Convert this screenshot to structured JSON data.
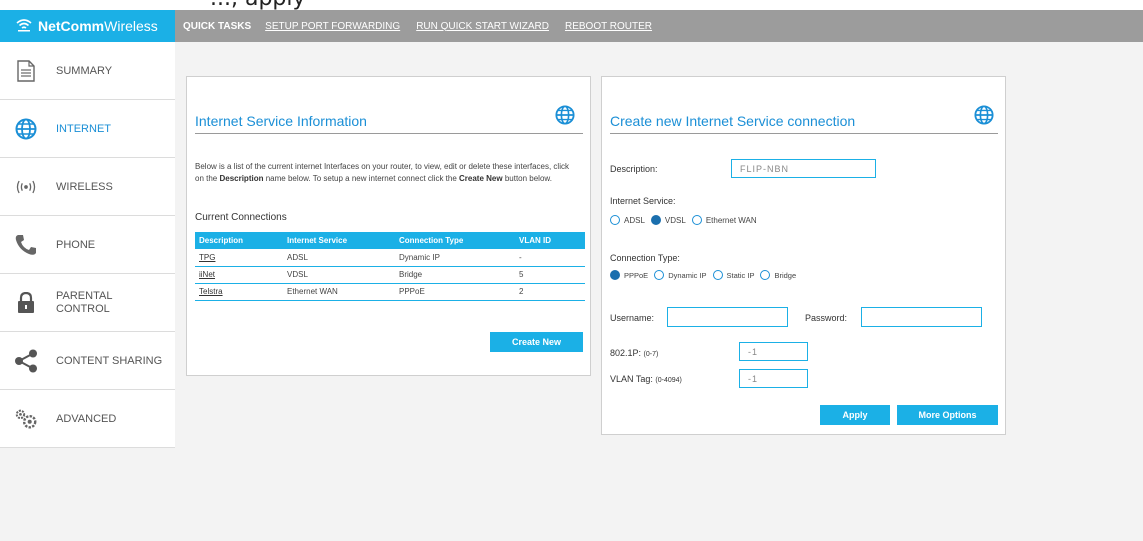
{
  "window": {
    "partial_text": "...,      apply"
  },
  "brand": {
    "name_bold": "NetComm",
    "name_rest": "Wireless"
  },
  "topnav": {
    "quick_tasks": "QUICK TASKS",
    "links": [
      "SETUP PORT FORWARDING",
      "RUN QUICK START WIZARD",
      "REBOOT ROUTER"
    ]
  },
  "sidebar": {
    "items": [
      {
        "label": "SUMMARY",
        "icon": "document-icon"
      },
      {
        "label": "INTERNET",
        "icon": "globe-icon",
        "active": true
      },
      {
        "label": "WIRELESS",
        "icon": "wireless-icon"
      },
      {
        "label": "PHONE",
        "icon": "phone-icon"
      },
      {
        "label": "PARENTAL",
        "label2": "CONTROL",
        "icon": "lock-icon"
      },
      {
        "label": "CONTENT SHARING",
        "icon": "share-icon"
      },
      {
        "label": "ADVANCED",
        "icon": "gears-icon"
      }
    ]
  },
  "info_panel": {
    "title": "Internet Service Information",
    "intro_1": "Below is a list of the current internet Interfaces on your router, to view, edit or delete these interfaces, click on the ",
    "intro_desc": "Description",
    "intro_2": " name below. To setup a new internet connect click the ",
    "intro_create": "Create New",
    "intro_3": " button below.",
    "current_connections": "Current Connections",
    "columns": [
      "Description",
      "Internet Service",
      "Connection Type",
      "VLAN ID"
    ],
    "rows": [
      [
        "TPG",
        "ADSL",
        "Dynamic IP",
        "-"
      ],
      [
        "iiNet",
        "VDSL",
        "Bridge",
        "5"
      ],
      [
        "Telstra",
        "Ethernet WAN",
        "PPPoE",
        "2"
      ]
    ],
    "create_new": "Create New"
  },
  "create_panel": {
    "title": "Create new Internet Service connection",
    "description_label": "Description:",
    "description_value": "FLIP-NBN",
    "internet_service_label": "Internet Service:",
    "internet_service_options": [
      "ADSL",
      "VDSL",
      "Ethernet WAN"
    ],
    "internet_service_selected": "VDSL",
    "connection_type_label": "Connection Type:",
    "connection_type_options": [
      "PPPoE",
      "Dynamic IP",
      "Static IP",
      "Bridge"
    ],
    "connection_type_selected": "PPPoE",
    "username_label": "Username:",
    "username_value": "",
    "password_label": "Password:",
    "password_value": "",
    "p8021_label": "802.1P:",
    "p8021_range": "(0-7)",
    "p8021_value": "-1",
    "vlan_label": "VLAN Tag:",
    "vlan_range": "(0-4094)",
    "vlan_value": "-1",
    "apply": "Apply",
    "more_options": "More Options"
  },
  "colors": {
    "accent": "#1bb0e6",
    "title_blue": "#1b8fd6",
    "nav_gray": "#9c9c9c"
  }
}
